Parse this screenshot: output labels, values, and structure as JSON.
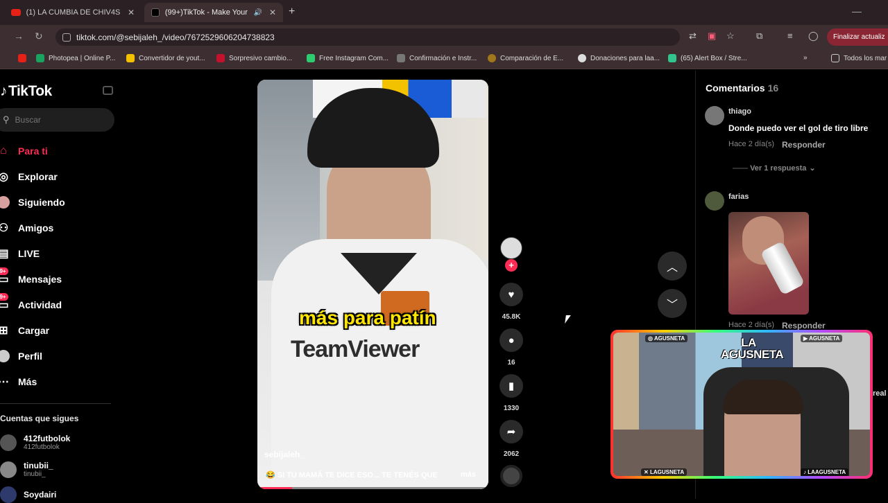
{
  "browser": {
    "tabs": [
      {
        "title": "(1) LA CUMBIA DE CHIV4S - Mi",
        "active": false
      },
      {
        "title": "(99+)TikTok - Make Your Da",
        "active": true
      }
    ],
    "url": "tiktok.com/@sebijaleh_/video/7672529606204738823",
    "update_label": "Finalizar actualiz",
    "bookmarks": [
      "Photopea | Online P...",
      "Convertidor de yout...",
      "Sorpresivo cambio...",
      "Free Instagram Com...",
      "Confirmación e Instr...",
      "Comparación de E...",
      "Donaciones para laa...",
      "(65) Alert Box / Stre...",
      "Todos los mar"
    ]
  },
  "sidebar": {
    "logo": "TikTok",
    "search_placeholder": "Buscar",
    "nav": [
      {
        "label": "Para ti",
        "icon": "home-icon",
        "active": true
      },
      {
        "label": "Explorar",
        "icon": "compass-icon"
      },
      {
        "label": "Siguiendo",
        "icon": "following-avatar-icon"
      },
      {
        "label": "Amigos",
        "icon": "friends-icon"
      },
      {
        "label": "LIVE",
        "icon": "live-icon"
      },
      {
        "label": "Mensajes",
        "icon": "messages-icon",
        "badge": "99+"
      },
      {
        "label": "Actividad",
        "icon": "activity-icon",
        "badge": "99+"
      },
      {
        "label": "Cargar",
        "icon": "upload-icon"
      },
      {
        "label": "Perfil",
        "icon": "profile-icon"
      },
      {
        "label": "Más",
        "icon": "more-icon"
      }
    ],
    "following_title": "Cuentas que sigues",
    "following": [
      {
        "name": "412futbolok",
        "handle": "412futbolok"
      },
      {
        "name": "tinubii_",
        "handle": "tinubii_"
      },
      {
        "name": "Soydairi",
        "handle": ""
      }
    ]
  },
  "video": {
    "caption_overlay": "más para patín",
    "sponsor_text": "TeamViewer",
    "username": "sebijaleh_",
    "description": "SI TU MAMÁ TE DICE ESO... TE TENÉS QUE",
    "more_label": "más",
    "progress": 0.15
  },
  "actions": {
    "likes": "45.8K",
    "comments": "16",
    "saves": "1330",
    "shares": "2062"
  },
  "comments_panel": {
    "title": "Comentarios",
    "count": "16",
    "items": [
      {
        "user": "thiago",
        "text": "Donde puedo ver el gol de tiro libre",
        "time": "Hace 2 día(s)",
        "reply": "Responder",
        "more_replies": "Ver 1 respuesta"
      },
      {
        "user": "farias",
        "time": "Hace 2 día(s)",
        "reply": "Responder"
      }
    ]
  },
  "stream_overlay": {
    "title": "LA AGUSNETA",
    "instagram": "AGUSNETA",
    "youtube": "AGUSNETA",
    "x": "LAGUSNETA",
    "tiktok": "LAAGUSNETA"
  },
  "edge_text": "real",
  "colors": {
    "accent": "#fe2c55",
    "chrome_bg": "#3c2e31"
  }
}
